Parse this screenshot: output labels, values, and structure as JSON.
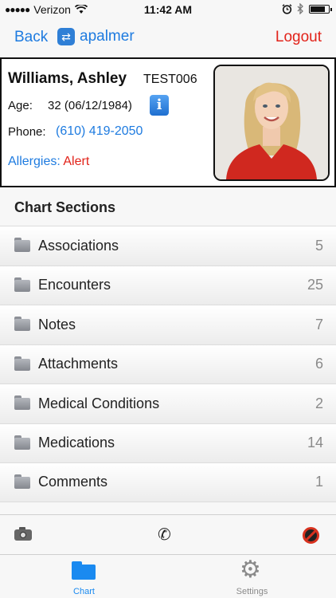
{
  "status_bar": {
    "carrier": "Verizon",
    "time": "11:42 AM"
  },
  "nav": {
    "back_label": "Back",
    "username": "apalmer",
    "logout_label": "Logout"
  },
  "patient": {
    "name": "Williams, Ashley",
    "id": "TEST006",
    "age_label": "Age:",
    "age_value": "32 (06/12/1984)",
    "phone_label": "Phone:",
    "phone_value": "(610) 419-2050",
    "allergies_label": "Allergies:",
    "allergies_value": "Alert"
  },
  "section_title": "Chart Sections",
  "chart_sections": [
    {
      "label": "Associations",
      "count": "5"
    },
    {
      "label": "Encounters",
      "count": "25"
    },
    {
      "label": "Notes",
      "count": "7"
    },
    {
      "label": "Attachments",
      "count": "6"
    },
    {
      "label": "Medical Conditions",
      "count": "2"
    },
    {
      "label": "Medications",
      "count": "14"
    },
    {
      "label": "Comments",
      "count": "1"
    }
  ],
  "tabs": [
    {
      "label": "Chart",
      "icon": "folder-icon",
      "selected": true
    },
    {
      "label": "Settings",
      "icon": "gear-icon",
      "selected": false
    }
  ],
  "colors": {
    "accent": "#1e7be0",
    "alert": "#e2231a"
  }
}
